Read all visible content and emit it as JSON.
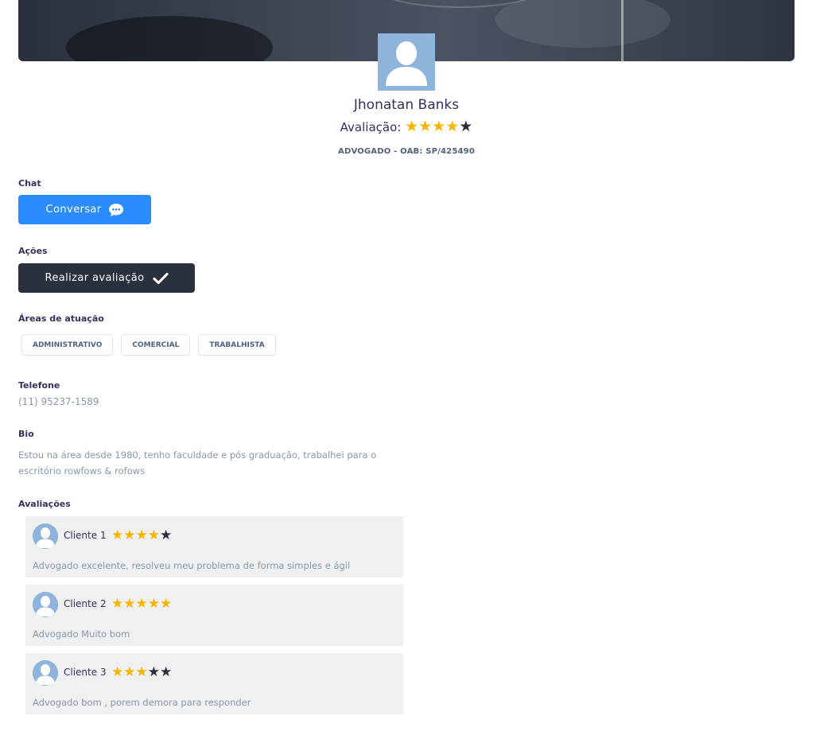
{
  "profile": {
    "name": "Jhonatan Banks",
    "rating_label": "Avaliação:",
    "rating": 4,
    "rating_max": 5,
    "subtitle": "ADVOGADO - OAB: SP/425490"
  },
  "sections": {
    "chat": "Chat",
    "actions": "Ações",
    "areas": "Áreas de atuação",
    "phone": "Telefone",
    "bio": "Bio",
    "reviews": "Avaliações"
  },
  "buttons": {
    "chat_label": "Conversar",
    "rate_label": "Realizar avaliação"
  },
  "areas": [
    "ADMINISTRATIVO",
    "COMERCIAL",
    "TRABALHISTA"
  ],
  "phone": "(11) 95237-1589",
  "bio": "Estou na área desde 1980, tenho faculdade e pós graduação, trabalhei para o escritório rowfows & rofows",
  "reviews": [
    {
      "client": "Cliente 1",
      "stars": 4,
      "text": "Advogado excelente, resolveu meu problema de forma simples e ágil"
    },
    {
      "client": "Cliente 2",
      "stars": 5,
      "text": "Advogado Muito bom"
    },
    {
      "client": "Cliente 3",
      "stars": 3,
      "text": "Advogado bom , porem demora para responder"
    }
  ],
  "colors": {
    "star_on": "#f7b500",
    "star_off": "#2b2f3b",
    "chat_button": "#2b8cff",
    "rate_button": "#2b303d",
    "avatar_bg": "#8fb4dc"
  },
  "icons": {
    "chat_button": "chat-bubble-icon",
    "rate_button": "check-icon",
    "avatar": "user-placeholder-icon"
  }
}
